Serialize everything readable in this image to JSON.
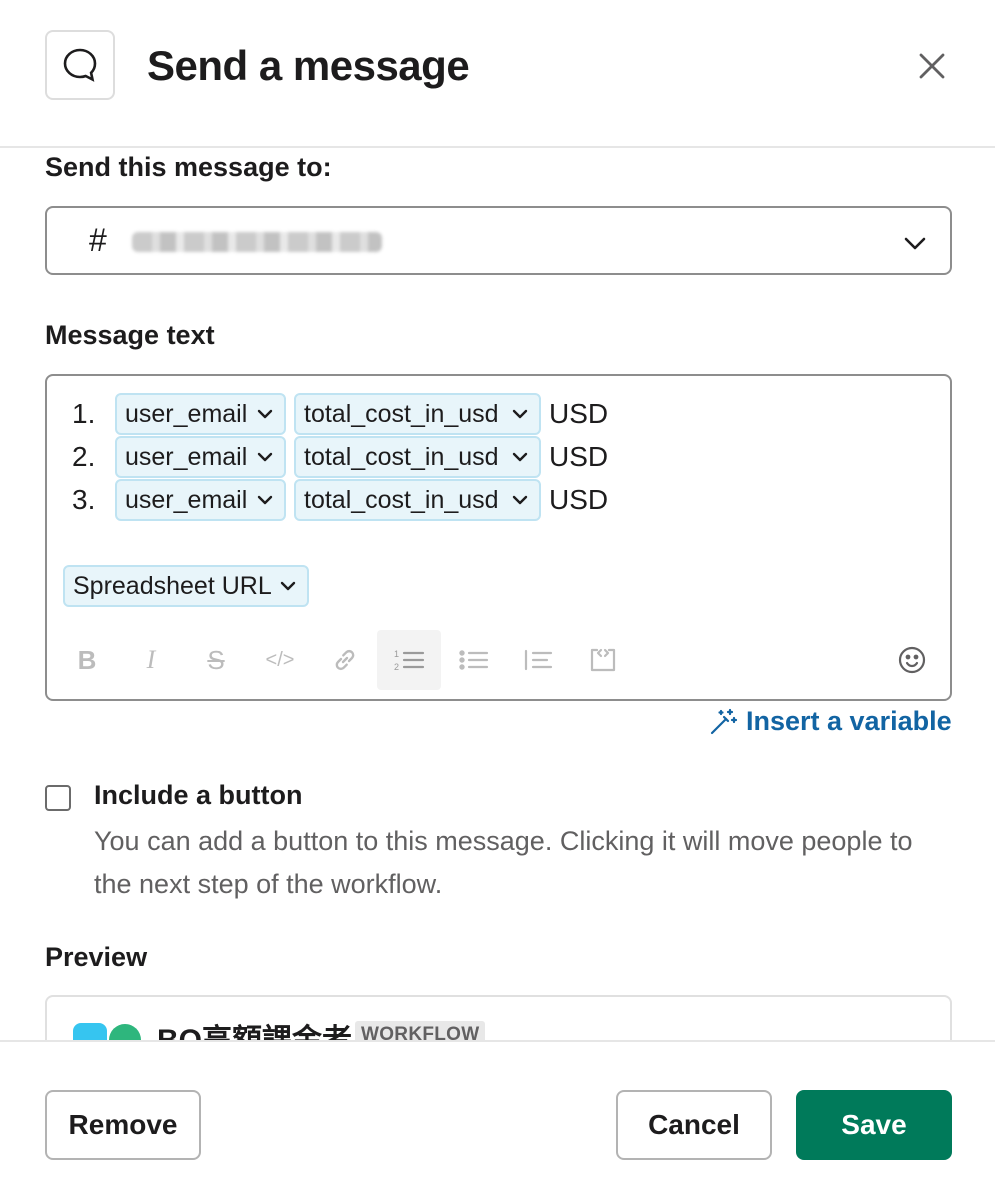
{
  "header": {
    "title": "Send a message",
    "icon": "message-bubble-icon",
    "close_icon": "close-icon"
  },
  "recipient": {
    "label": "Send this message to:",
    "prefix": "#",
    "value_redacted": true
  },
  "message": {
    "label": "Message text",
    "lines": [
      {
        "number": "1.",
        "var1": "user_email",
        "var2": "total_cost_in_usd",
        "suffix": "USD"
      },
      {
        "number": "2.",
        "var1": "user_email",
        "var2": "total_cost_in_usd",
        "suffix": "USD"
      },
      {
        "number": "3.",
        "var1": "user_email",
        "var2": "total_cost_in_usd",
        "suffix": "USD"
      }
    ],
    "extra_variable": "Spreadsheet URL",
    "toolbar": [
      "bold-icon",
      "italic-icon",
      "strikethrough-icon",
      "code-icon",
      "link-icon",
      "ordered-list-icon",
      "bulleted-list-icon",
      "blockquote-icon",
      "code-block-icon",
      "emoji-icon"
    ]
  },
  "insert_variable": {
    "label": "Insert a variable",
    "icon": "magic-wand-icon"
  },
  "include_button": {
    "label": "Include a button",
    "checked": false,
    "description": "You can add a button to this message. Clicking it will move people to the next step of the workflow."
  },
  "preview": {
    "label": "Preview",
    "sender": "BQ高額課金者",
    "badge": "WORKFLOW"
  },
  "footer": {
    "remove": "Remove",
    "cancel": "Cancel",
    "save": "Save"
  },
  "colors": {
    "accent": "#007a5a",
    "link": "#1264a3",
    "chip_bg": "#e8f5fa",
    "chip_border": "#bfe3f2"
  }
}
